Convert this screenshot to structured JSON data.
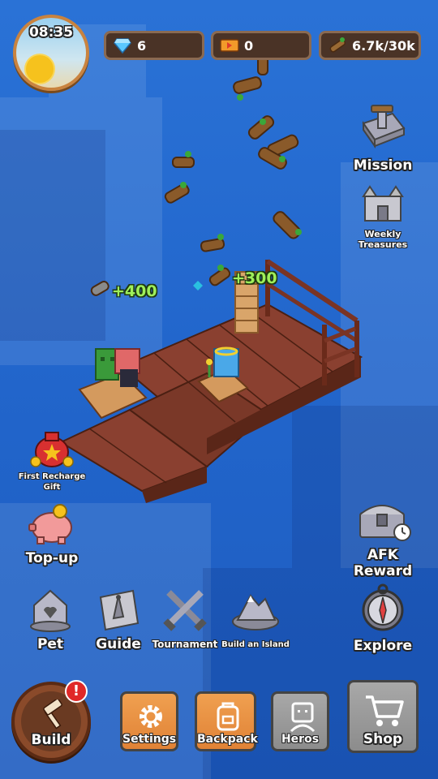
{
  "clock": {
    "time": "08:35"
  },
  "resources": {
    "gems": "6",
    "tickets": "0",
    "wood": "6.7k/30k"
  },
  "floating": {
    "gain1": "+400",
    "gain2": "+300"
  },
  "side_right": {
    "mission": "Mission",
    "weekly_line1": "Weekly",
    "weekly_line2": "Treasures",
    "afk_line1": "AFK",
    "afk_line2": "Reward",
    "explore": "Explore"
  },
  "side_left": {
    "first_recharge_line1": "First Recharge",
    "first_recharge_line2": "Gift",
    "topup": "Top-up"
  },
  "quick_row": {
    "pet": "Pet",
    "guide": "Guide",
    "tournament": "Tournament",
    "build_island": "Build an Island"
  },
  "bottom_bar": {
    "build": "Build",
    "build_badge": "!",
    "settings": "Settings",
    "backpack": "Backpack",
    "heros": "Heros",
    "shop": "Shop"
  },
  "colors": {
    "accent_wood": "#8a4a2a",
    "alert": "#e02828",
    "gain": "#9eef5a"
  }
}
